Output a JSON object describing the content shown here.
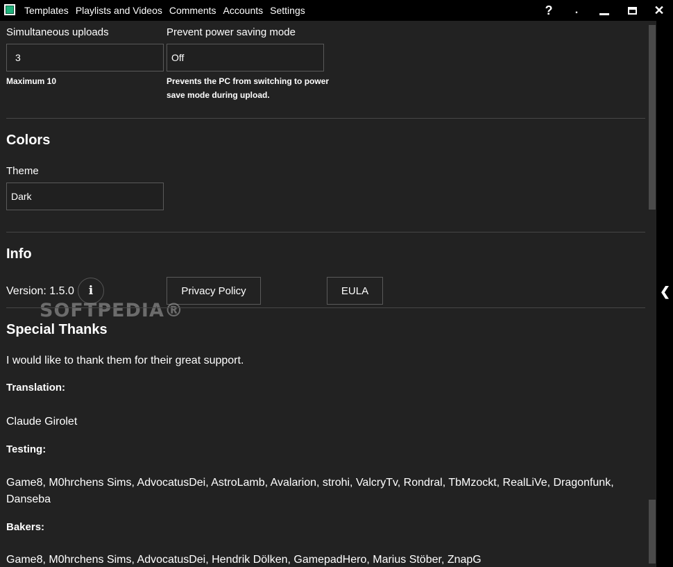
{
  "menu": {
    "items": [
      "Templates",
      "Playlists and Videos",
      "Comments",
      "Accounts",
      "Settings"
    ]
  },
  "window": {
    "help": "?",
    "dot": ".",
    "close": "✕"
  },
  "upload": {
    "simultaneous_label": "Simultaneous uploads",
    "simultaneous_value": "3",
    "simultaneous_note": "Maximum 10",
    "power_label": "Prevent power saving mode",
    "power_value": "Off",
    "power_note_line1": "Prevents the PC from switching to power",
    "power_note_line2": "save mode during upload."
  },
  "colors": {
    "heading": "Colors",
    "theme_label": "Theme",
    "theme_value": "Dark"
  },
  "info": {
    "heading": "Info",
    "version": "Version: 1.5.0",
    "info_glyph": "i",
    "privacy_label": "Privacy Policy",
    "eula_label": "EULA"
  },
  "watermark": "SOFTPEDIA®",
  "thanks": {
    "heading": "Special Thanks",
    "intro": "I would like to thank them for their great support.",
    "translation_label": "Translation:",
    "translation_names": "Claude Girolet",
    "testing_label": "Testing:",
    "testing_names_line1": "Game8, M0hrchens Sims, AdvocatusDei, AstroLamb, Avalarion, strohi, ValcryTv, Rondral, TbMzockt, RealLiVe, Dragonfunk,",
    "testing_names_line2": "Danseba",
    "bakers_label": "Bakers:",
    "bakers_names": "Game8, M0hrchens Sims, AdvocatusDei, Hendrik Dölken, GamepadHero, Marius Stöber, ZnapG"
  },
  "colors_palette": {
    "accent": "#1fb07a",
    "background": "#222222",
    "titlebar": "#000000"
  },
  "icons": [
    "app-icon",
    "help-icon",
    "minimize-icon",
    "maximize-icon",
    "close-icon",
    "info-icon",
    "chevron-left-icon"
  ]
}
